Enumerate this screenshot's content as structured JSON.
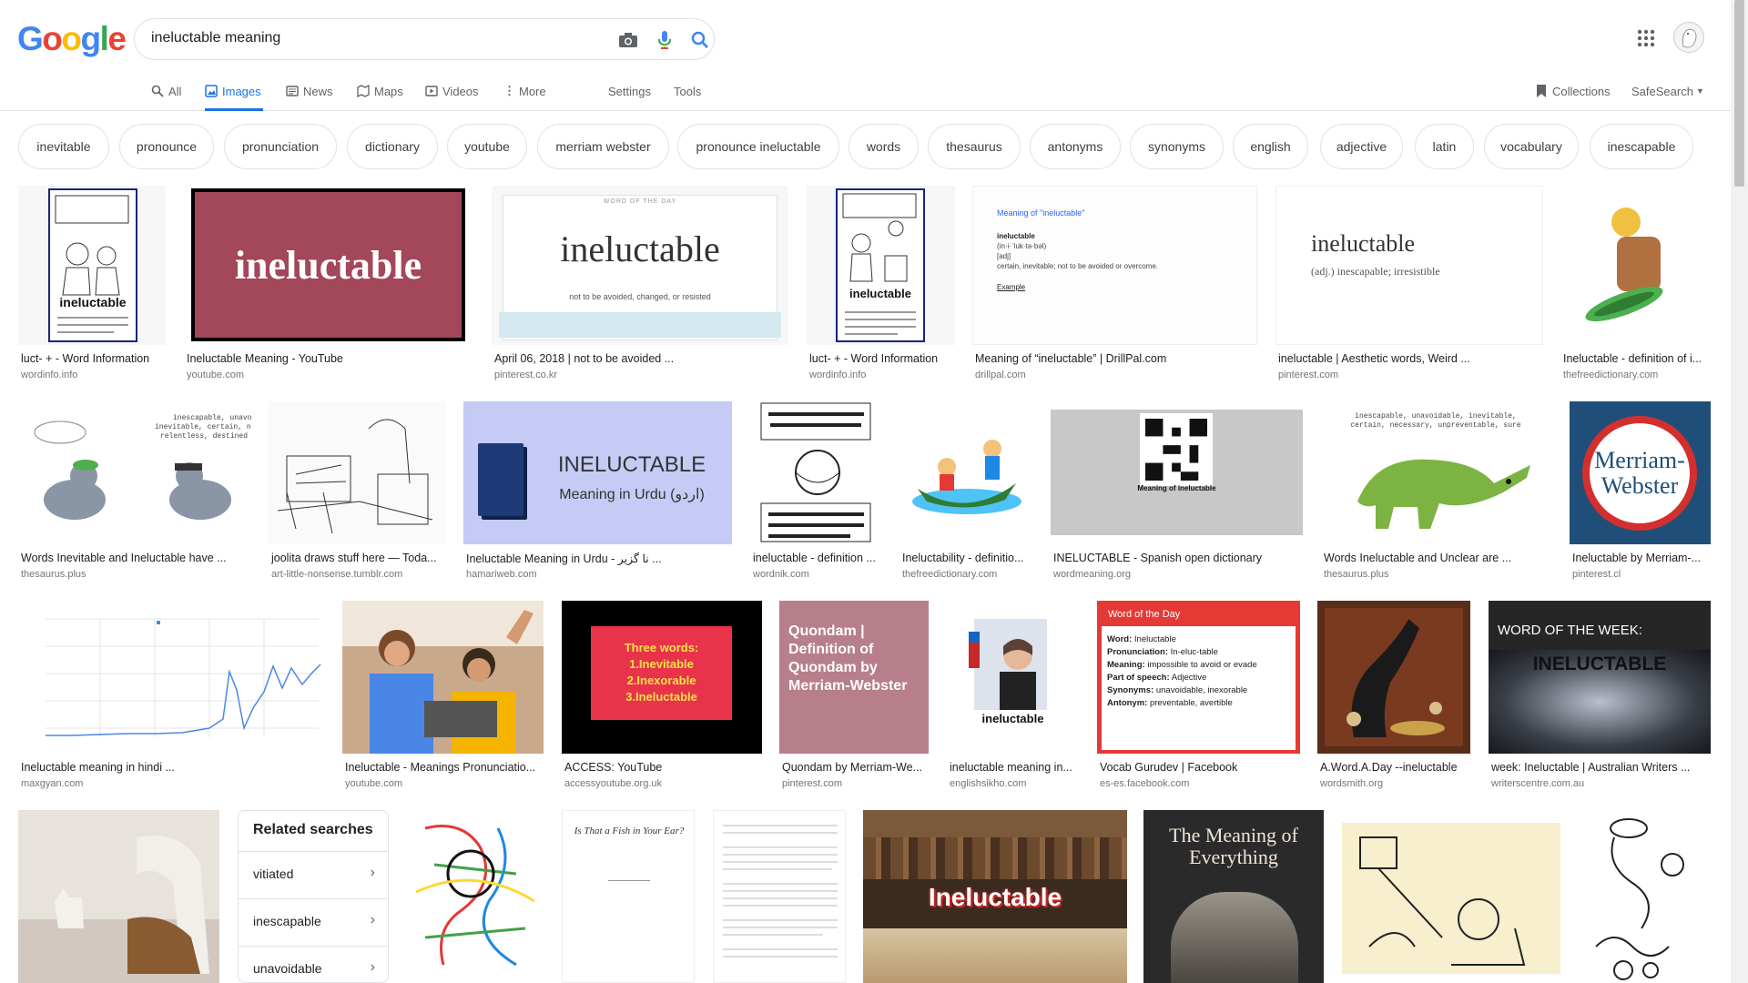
{
  "logo": "Google",
  "search": {
    "query": "ineluctable meaning"
  },
  "tabs": {
    "all": "All",
    "images": "Images",
    "news": "News",
    "maps": "Maps",
    "videos": "Videos",
    "more": "More",
    "settings": "Settings",
    "tools": "Tools",
    "collections": "Collections",
    "safesearch": "SafeSearch"
  },
  "chips": [
    "inevitable",
    "pronounce",
    "pronunciation",
    "dictionary",
    "youtube",
    "merriam webster",
    "pronounce ineluctable",
    "words",
    "thesaurus",
    "antonyms",
    "synonyms",
    "english",
    "adjective",
    "latin",
    "vocabulary",
    "inescapable"
  ],
  "results": [
    {
      "title": "luct- + - Word Information",
      "source": "wordinfo.info"
    },
    {
      "title": "Ineluctable Meaning - YouTube",
      "source": "youtube.com",
      "img_text": "ineluctable"
    },
    {
      "title": "April 06, 2018 | not to be avoided ...",
      "source": "pinterest.co.kr",
      "img_text": "ineluctable",
      "img_sub": "not to be avoided, changed, or resisted",
      "img_top": "WORD OF THE DAY"
    },
    {
      "title": "luct- + - Word Information",
      "source": "wordinfo.info"
    },
    {
      "title": "Meaning of “ineluctable” | DrillPal.com",
      "source": "drillpal.com",
      "img_text": "Meaning of \"ineluctable\"",
      "img_sub": "certain, inevitable; not to be avoided or overcome."
    },
    {
      "title": "ineluctable | Aesthetic words, Weird ...",
      "source": "pinterest.com",
      "img_text": "ineluctable",
      "img_sub": "(adj.) inescapable; irresistible"
    },
    {
      "title": "Ineluctable - definition of i...",
      "source": "thefreedictionary.com"
    },
    {
      "title": "Words Inevitable and Ineluctable have ...",
      "source": "thesaurus.plus"
    },
    {
      "title": "joolita draws stuff here — Toda...",
      "source": "art-little-nonsense.tumblr.com"
    },
    {
      "title": "Ineluctable Meaning in Urdu - نا گزیر ...",
      "source": "hamariweb.com",
      "img_text": "INELUCTABLE",
      "img_sub": "Meaning in Urdu (اردو)"
    },
    {
      "title": "ineluctable - definition ...",
      "source": "wordnik.com"
    },
    {
      "title": "Ineluctability - definitio...",
      "source": "thefreedictionary.com"
    },
    {
      "title": "INELUCTABLE - Spanish open dictionary",
      "source": "wordmeaning.org",
      "img_text": "Meaning of ineluctable"
    },
    {
      "title": "Words Ineluctable and Unclear are ...",
      "source": "thesaurus.plus"
    },
    {
      "title": "Ineluctable by Merriam-...",
      "source": "pinterest.cl",
      "img_text": "Merriam-Webster"
    },
    {
      "title": "Ineluctable meaning in hindi ...",
      "source": "maxgyan.com"
    },
    {
      "title": "Ineluctable - Meanings Pronunciatio...",
      "source": "youtube.com"
    },
    {
      "title": "ACCESS: YouTube",
      "source": "accessyoutube.org.uk",
      "img_text": "Three words:",
      "img_lines": [
        "1.Inevitable",
        "2.Inexorable",
        "3.Ineluctable"
      ]
    },
    {
      "title": "Quondam by Merriam-We...",
      "source": "pinterest.com",
      "img_text": "Quondam | Definition of Quondam by Merriam-Webster"
    },
    {
      "title": "ineluctable meaning in...",
      "source": "englishsikho.com",
      "img_text": "ineluctable"
    },
    {
      "title": "Vocab Gurudev | Facebook",
      "source": "es-es.facebook.com",
      "img_text": "Word of the Day"
    },
    {
      "title": "A.Word.A.Day --ineluctable",
      "source": "wordsmith.org"
    },
    {
      "title": "week: Ineluctable | Australian Writers ...",
      "source": "writerscentre.com.au",
      "img_text": "WORD OF THE WEEK:",
      "img_sub": "INELUCTABLE"
    },
    {
      "title": "",
      "source": ""
    },
    {
      "title": "",
      "source": ""
    },
    {
      "title": "",
      "source": "",
      "img_text": "Is That a Fish in Your Ear?"
    },
    {
      "title": "",
      "source": ""
    },
    {
      "title": "",
      "source": "",
      "img_text": "Ineluctable"
    },
    {
      "title": "",
      "source": "",
      "img_text": "The Meaning of Everything"
    },
    {
      "title": "",
      "source": ""
    },
    {
      "title": "",
      "source": ""
    }
  ],
  "related": {
    "heading": "Related searches",
    "items": [
      "vitiated",
      "inescapable",
      "unavoidable"
    ]
  }
}
